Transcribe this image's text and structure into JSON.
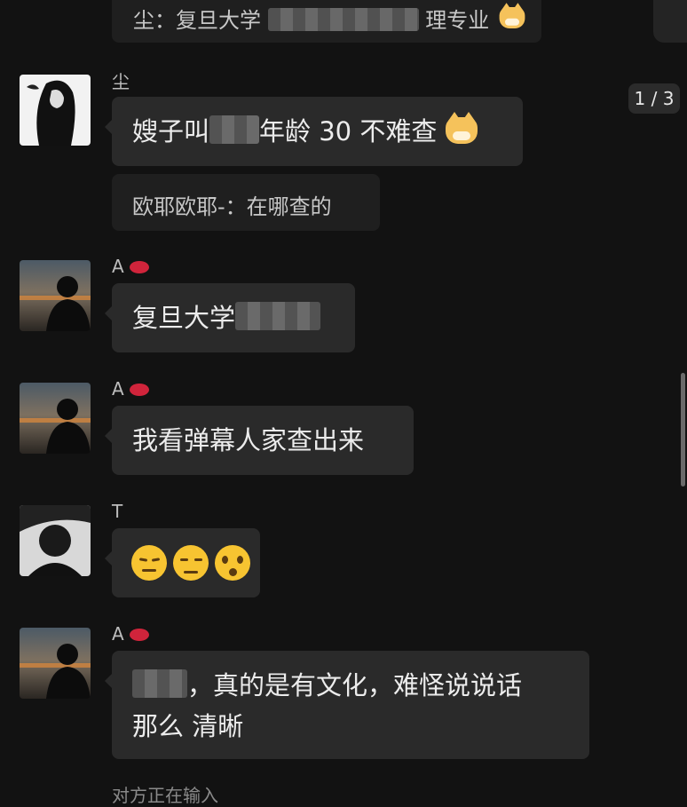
{
  "counter": {
    "label": "1 / 3"
  },
  "messages": [
    {
      "quote_visible": "尘：复旦大学",
      "quote_tail": "理专业"
    },
    {
      "sender": "尘",
      "text_a": "嫂子叫",
      "text_b": "年龄 30 不难查"
    },
    {
      "quote": "欧耶欧耶-：在哪查的"
    },
    {
      "sender": "A",
      "text": "复旦大学"
    },
    {
      "sender": "A",
      "text": "我看弹幕人家查出来"
    },
    {
      "sender": "T"
    },
    {
      "sender": "A",
      "line1": "，真的是有文化，难怪说说话",
      "line2": "那么 清晰"
    }
  ],
  "footer": {
    "partial": "对方正在输入"
  },
  "colors": {
    "background": "#121212",
    "bubble": "#2a2a2a",
    "text": "#ececec"
  }
}
